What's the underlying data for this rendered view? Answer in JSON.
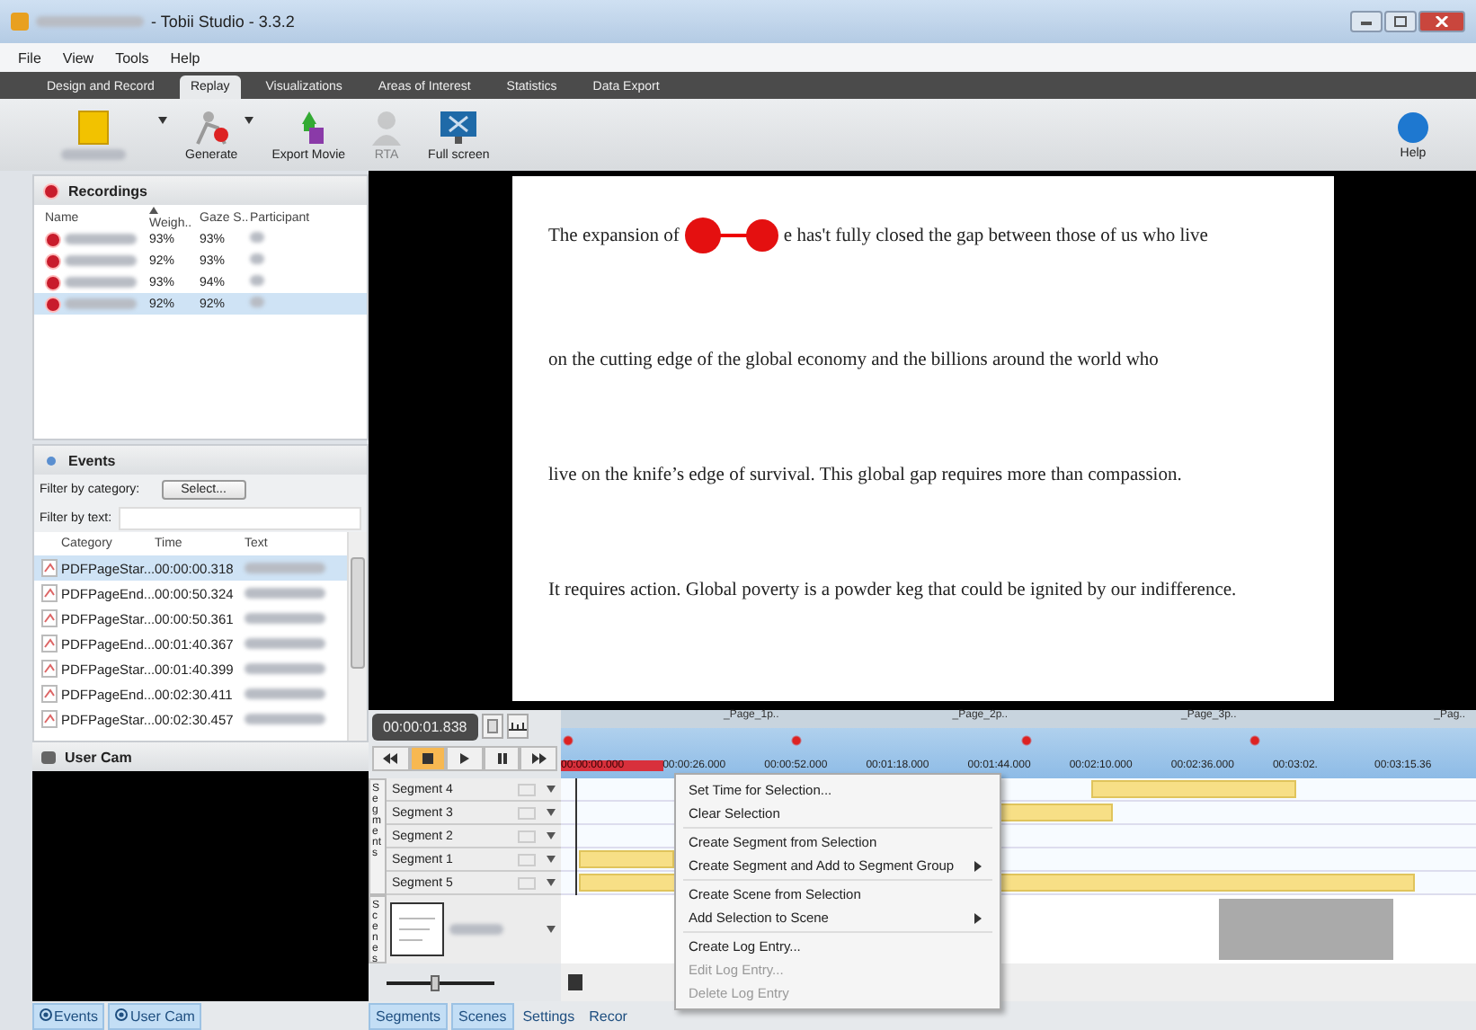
{
  "window": {
    "title": "- Tobii Studio - 3.3.2"
  },
  "menu": [
    "File",
    "View",
    "Tools",
    "Help"
  ],
  "tabs": [
    {
      "label": "Design and Record",
      "selected": false
    },
    {
      "label": "Replay",
      "selected": true
    },
    {
      "label": "Visualizations",
      "selected": false
    },
    {
      "label": "Areas of Interest",
      "selected": false
    },
    {
      "label": "Statistics",
      "selected": false
    },
    {
      "label": "Data Export",
      "selected": false
    }
  ],
  "toolbar": [
    {
      "kind": "folder",
      "dropdown": true,
      "disabled": false
    },
    {
      "kind": "generate",
      "label": "Generate",
      "dropdown": true,
      "disabled": false
    },
    {
      "kind": "movie",
      "label": "Export Movie",
      "dropdown": false,
      "disabled": false
    },
    {
      "kind": "person",
      "label": "RTA",
      "dropdown": false,
      "disabled": true
    },
    {
      "kind": "screen",
      "label": "Full screen",
      "dropdown": false,
      "disabled": false
    }
  ],
  "help": {
    "label": "Help"
  },
  "recordings": {
    "title": "Recordings",
    "columns": [
      "Name",
      "Weigh..",
      "Gaze S..",
      "Participant"
    ],
    "rows": [
      {
        "weight": "93%",
        "gaze": "93%",
        "selected": false
      },
      {
        "weight": "92%",
        "gaze": "93%",
        "selected": false
      },
      {
        "weight": "93%",
        "gaze": "94%",
        "selected": false
      },
      {
        "weight": "92%",
        "gaze": "92%",
        "selected": true
      }
    ]
  },
  "events": {
    "title": "Events",
    "category_label": "Filter by category:",
    "select_button": "Select...",
    "text_label": "Filter by text:",
    "columns": [
      "Category",
      "Time",
      "Text"
    ],
    "rows": [
      {
        "category": "PDFPageStar...",
        "time": "00:00:00.318",
        "selected": true
      },
      {
        "category": "PDFPageEnd...",
        "time": "00:00:50.324",
        "selected": false
      },
      {
        "category": "PDFPageStar...",
        "time": "00:00:50.361",
        "selected": false
      },
      {
        "category": "PDFPageEnd...",
        "time": "00:01:40.367",
        "selected": false
      },
      {
        "category": "PDFPageStar...",
        "time": "00:01:40.399",
        "selected": false
      },
      {
        "category": "PDFPageEnd...",
        "time": "00:02:30.411",
        "selected": false
      },
      {
        "category": "PDFPageStar...",
        "time": "00:02:30.457",
        "selected": false
      }
    ]
  },
  "user_cam": {
    "title": "User Cam"
  },
  "left_tabs": [
    {
      "label": "Events",
      "selected": true
    },
    {
      "label": "User Cam",
      "selected": true
    }
  ],
  "stimulus": {
    "lines": [
      [
        "The expansion of",
        "e has't fully closed the gap between those of us who live"
      ],
      [
        "on the cutting edge of the global economy and the billions around the world who"
      ],
      [
        "live on the knife’s edge of survival. This global gap requires more than compassion."
      ],
      [
        "It requires action. Global poverty is a powder keg that could be ignited by our indifference."
      ]
    ]
  },
  "timeline": {
    "time": "00:00:01.838",
    "pages": [
      "_Page_1p..",
      "_Page_2p..",
      "_Page_3p..",
      "_Pag.."
    ],
    "ruler": [
      "00:00:00.000",
      "00:00:26.000",
      "00:00:52.000",
      "00:01:18.000",
      "00:01:44.000",
      "00:02:10.000",
      "00:02:36.000",
      "00:03:02.",
      "00:03:15.36"
    ],
    "segments": [
      "Segment 4",
      "Segment 3",
      "Segment 2",
      "Segment 1",
      "Segment 5"
    ],
    "segments_label": "Segments",
    "scenes_label": "Scenes",
    "zoom": {
      "level": 0.45
    }
  },
  "context_menu": [
    {
      "kind": "item",
      "label": "Set Time for Selection...",
      "disabled": false,
      "submenu": false
    },
    {
      "kind": "item",
      "label": "Clear Selection",
      "disabled": false,
      "submenu": false
    },
    {
      "kind": "separator"
    },
    {
      "kind": "item",
      "label": "Create Segment from Selection",
      "disabled": false,
      "submenu": false
    },
    {
      "kind": "item",
      "label": "Create Segment and Add to Segment Group",
      "disabled": false,
      "submenu": true
    },
    {
      "kind": "separator"
    },
    {
      "kind": "item",
      "label": "Create Scene from Selection",
      "disabled": false,
      "submenu": false
    },
    {
      "kind": "item",
      "label": "Add Selection to Scene",
      "disabled": false,
      "submenu": true
    },
    {
      "kind": "separator"
    },
    {
      "kind": "item",
      "label": "Create Log Entry...",
      "disabled": false,
      "submenu": false
    },
    {
      "kind": "item",
      "label": "Edit Log Entry...",
      "disabled": true,
      "submenu": false
    },
    {
      "kind": "item",
      "label": "Delete Log Entry",
      "disabled": true,
      "submenu": false
    }
  ],
  "bottom_tabs": [
    {
      "label": "Segments",
      "selected": true
    },
    {
      "label": "Scenes",
      "selected": true
    },
    {
      "label": "Settings",
      "selected": false
    },
    {
      "label": "Recor",
      "selected": false
    }
  ]
}
